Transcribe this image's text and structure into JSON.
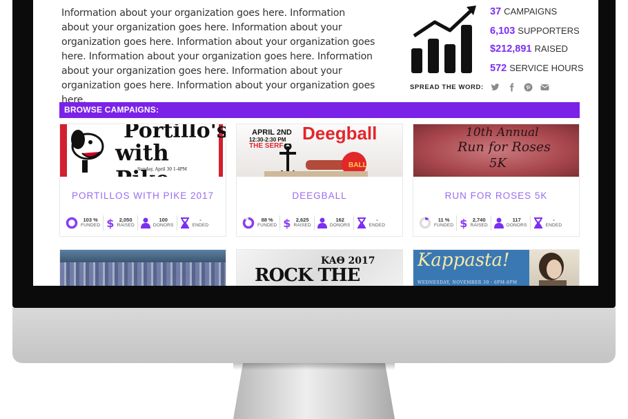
{
  "about": {
    "text": "Information about your organization goes here. Information about your organization goes here. Information about your organization goes here. Information about your organization goes here. Information about your organization goes here. Information about your organization goes here. Information about your organization goes here. Information about your organization goes here."
  },
  "stats": {
    "campaigns": {
      "num": "37",
      "label": "CAMPAIGNS"
    },
    "supporters": {
      "num": "6,103",
      "label": "SUPPORTERS"
    },
    "raised": {
      "num": "$212,891",
      "label": "RAISED"
    },
    "hours": {
      "num": "572",
      "label": "SERVICE HOURS"
    }
  },
  "spread": {
    "label": "SPREAD THE WORD:",
    "icons": [
      "twitter-icon",
      "facebook-icon",
      "pinterest-icon",
      "email-icon"
    ]
  },
  "browse": {
    "label": "BROWSE CAMPAIGNS:"
  },
  "colors": {
    "accent": "#7b22e8",
    "title": "#9a6bf0"
  },
  "campaigns": [
    {
      "title": "PORTILLOS WITH PIKE 2017",
      "image_text": [
        "Portillo's",
        "with Pike",
        "Sunday, April 30 1-4PM"
      ],
      "funded": "103 %",
      "funded_pct": 103,
      "raised": "2,050",
      "donors": "100",
      "ended": "-",
      "labels": {
        "funded": "FUNDED",
        "raised": "RAISED",
        "donors": "DONORS",
        "ended": "ENDED"
      }
    },
    {
      "title": "DEEGBALL",
      "image_text": [
        "APRIL 2ND",
        "12:30-2:30 PM",
        "THE SERF",
        "Deegball",
        "BALL"
      ],
      "funded": "88 %",
      "funded_pct": 88,
      "raised": "2,625",
      "donors": "162",
      "ended": "-",
      "labels": {
        "funded": "FUNDED",
        "raised": "RAISED",
        "donors": "DONORS",
        "ended": "ENDED"
      }
    },
    {
      "title": "RUN FOR ROSES 5K",
      "image_text": [
        "10th Annual",
        "Run for Roses",
        "5K"
      ],
      "funded": "11 %",
      "funded_pct": 11,
      "raised": "2,740",
      "donors": "117",
      "ended": "-",
      "labels": {
        "funded": "FUNDED",
        "raised": "RAISED",
        "donors": "DONORS",
        "ended": "ENDED"
      }
    }
  ],
  "second_row": [
    {
      "image_text": []
    },
    {
      "image_text": [
        "KAΘ 2017",
        "ROCK THE CASA"
      ]
    },
    {
      "image_text": [
        "Kappasta!",
        "WEDNESDAY, NOVEMBER 30 · 6PM-8PM"
      ]
    }
  ]
}
